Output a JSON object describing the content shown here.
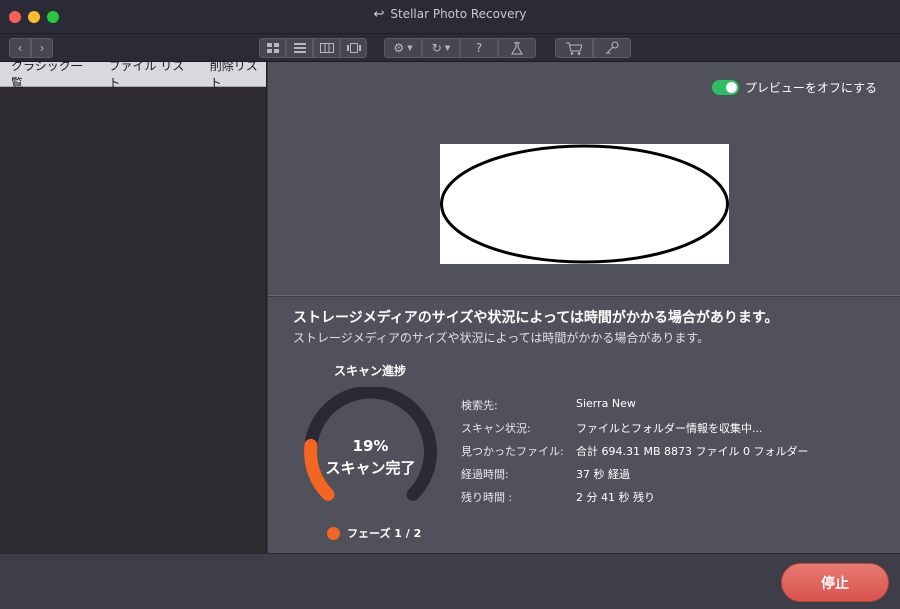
{
  "window": {
    "title": "Stellar Photo Recovery"
  },
  "toolbar": {
    "nav_back_icon": "chevron-left-icon",
    "nav_forward_icon": "chevron-right-icon",
    "help_label": "?"
  },
  "sidebar": {
    "tabs": [
      {
        "label": "クラシック一覧"
      },
      {
        "label": "ファイル リスト"
      },
      {
        "label": "削除リスト"
      }
    ]
  },
  "preview": {
    "toggle_label": "プレビューをオフにする",
    "toggle_on": true,
    "toggle_color": "#2fbf62"
  },
  "scan": {
    "headline": "ストレージメディアのサイズや状況によっては時間がかかる場合があります。",
    "subline": "ストレージメディアのサイズや状況によっては時間がかかる場合があります。",
    "progress_title": "スキャン進捗",
    "percent": "19%",
    "progress_fraction": 0.19,
    "status_label": "スキャン完了",
    "phase": "フェーズ 1 / 2",
    "accent_color": "#f26522",
    "details": [
      {
        "label": "検索先:",
        "value": "Sierra New"
      },
      {
        "label": "スキャン状況:",
        "value": "ファイルとフォルダー情報を収集中..."
      },
      {
        "label": "見つかったファイル:",
        "value": "合計 694.31 MB 8873 ファイル 0 フォルダー"
      },
      {
        "label": "経過時間:",
        "value": "37 秒 経過"
      },
      {
        "label": "残り時間 :",
        "value": "2 分 41 秒 残り"
      }
    ]
  },
  "footer": {
    "stop_label": "停止"
  }
}
